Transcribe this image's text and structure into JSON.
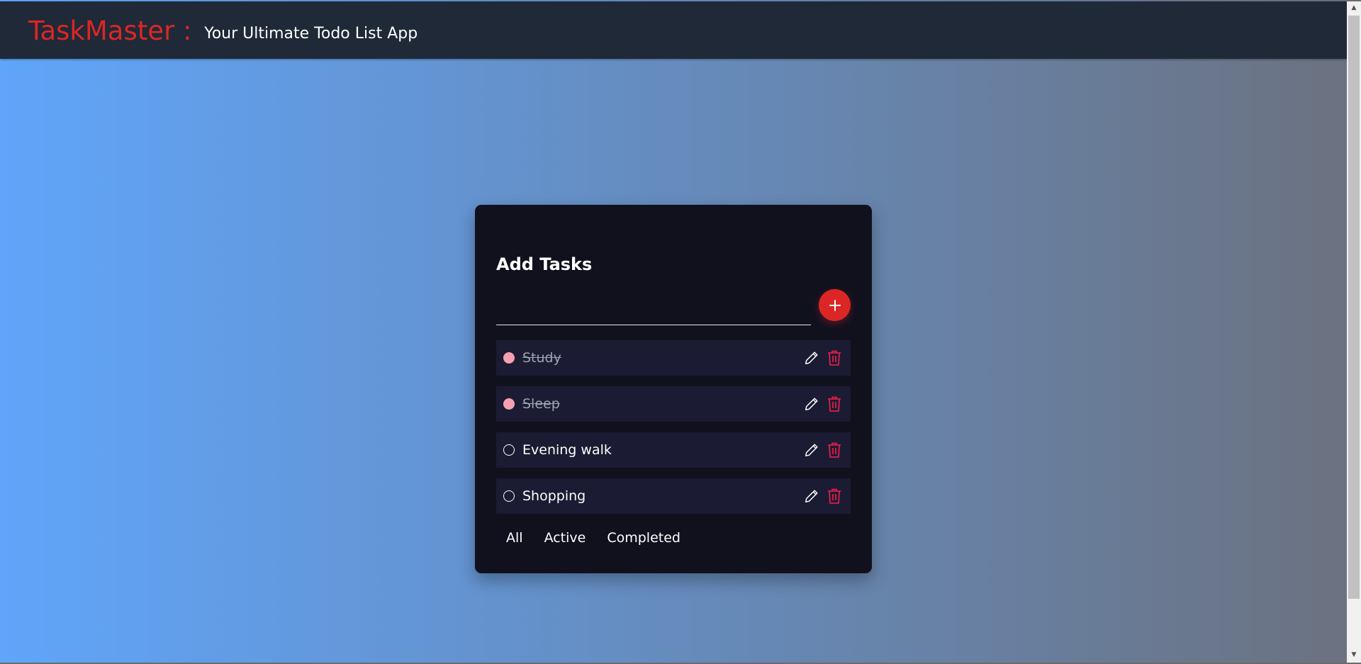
{
  "header": {
    "brand": "TaskMaster :",
    "tagline": "Your Ultimate Todo List App"
  },
  "card": {
    "title": "Add Tasks",
    "input": {
      "value": "",
      "placeholder": ""
    },
    "add_button_icon": "plus-icon"
  },
  "tasks": [
    {
      "label": "Study",
      "completed": true
    },
    {
      "label": "Sleep",
      "completed": true
    },
    {
      "label": "Evening walk",
      "completed": false
    },
    {
      "label": "Shopping",
      "completed": false
    }
  ],
  "filters": [
    {
      "label": "All"
    },
    {
      "label": "Active"
    },
    {
      "label": "Completed"
    }
  ],
  "icons": {
    "edit": "pencil-icon",
    "delete": "trash-icon"
  },
  "colors": {
    "brand": "#dc2626",
    "navbar": "#1f2937",
    "card": "#11111e",
    "task_row": "#1b1b33",
    "completed_dot": "#f4a0b0",
    "gradient_start": "#60a5fa",
    "gradient_end": "#6b7280"
  }
}
